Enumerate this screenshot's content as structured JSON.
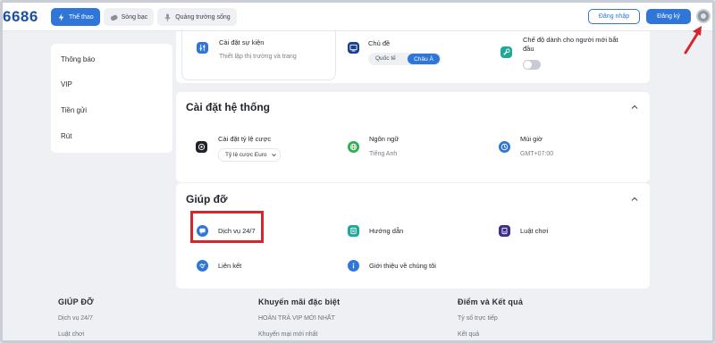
{
  "header": {
    "logo": "6686",
    "nav": [
      {
        "label": "Thể thao",
        "icon": "lightning-icon",
        "active": true
      },
      {
        "label": "Sòng bạc",
        "icon": "cloud-icon",
        "active": false
      },
      {
        "label": "Quảng trường sống",
        "icon": "microphone-icon",
        "active": false
      }
    ],
    "login_label": "Đăng nhập",
    "register_label": "Đăng ký"
  },
  "sidebar": {
    "items": [
      {
        "label": "Thông báo"
      },
      {
        "label": "VIP"
      },
      {
        "label": "Tiền gửi"
      },
      {
        "label": "Rút"
      }
    ]
  },
  "top_settings": {
    "event_title": "Cài đặt sự kiện",
    "event_sub": "Thiết lập thị trường và trang",
    "theme_title": "Chủ đề",
    "theme_options": [
      "Quốc tế",
      "Châu Á"
    ],
    "theme_selected": "Châu Á",
    "beginner_title_1": "Chế độ dành cho người mới bắt",
    "beginner_title_2": "đầu",
    "beginner_enabled": false
  },
  "system_settings": {
    "title": "Cài đặt hệ thống",
    "odds_title": "Cài đặt tỷ lệ cược",
    "odds_value": "Tỷ lệ cược Euro",
    "language_title": "Ngôn ngữ",
    "language_value": "Tiếng Anh",
    "timezone_title": "Múi giờ",
    "timezone_value": "GMT+07:00"
  },
  "help": {
    "title": "Giúp đỡ",
    "support": "Dịch vụ 24/7",
    "guide": "Hướng dẫn",
    "rules": "Luật chơi",
    "links": "Liên kết",
    "about": "Giới thiệu về chúng tôi"
  },
  "footer": {
    "col1": {
      "title": "GIÚP ĐỠ",
      "links": [
        "Dịch vụ 24/7",
        "Luật chơi"
      ]
    },
    "col2": {
      "title": "Khuyến mãi đặc biệt",
      "links": [
        "HOÀN TRẢ VIP MỚI NHẤT",
        "Khuyến mại mới nhất"
      ]
    },
    "col3": {
      "title": "Điểm và Kết quả",
      "links": [
        "Tỷ số trực tiếp",
        "Kết quả"
      ]
    }
  },
  "colors": {
    "accent": "#2f76d8",
    "annotation": "#d6262b"
  }
}
